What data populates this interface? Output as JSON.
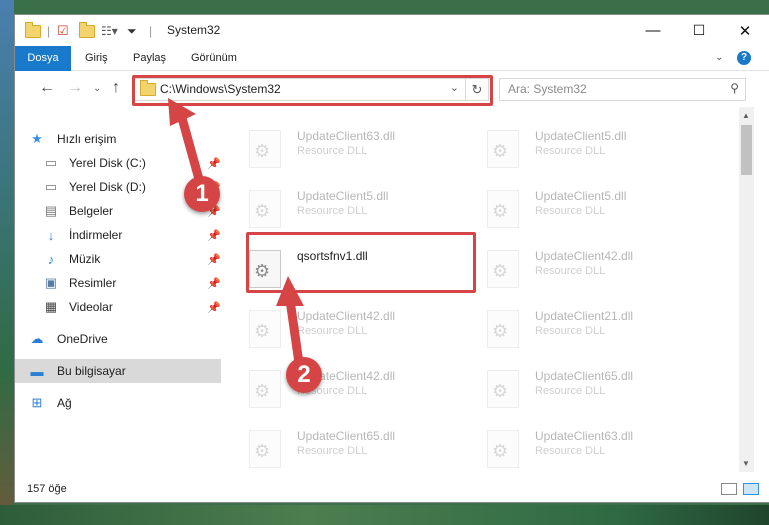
{
  "window": {
    "title": "System32",
    "controls": {
      "minimize": "—",
      "maximize": "☐",
      "close": "✕"
    }
  },
  "ribbon": {
    "tabs": [
      "Dosya",
      "Giriş",
      "Paylaş",
      "Görünüm"
    ],
    "expand_icon": "chevron-down-icon",
    "help": "?"
  },
  "address": {
    "path": "C:\\Windows\\System32",
    "dropdown": "⌄",
    "refresh": "↻"
  },
  "search": {
    "placeholder": "Ara: System32"
  },
  "nav": {
    "items": [
      {
        "label": "Hızlı erişim",
        "icon": "star-icon",
        "pinned": false
      },
      {
        "label": "Yerel Disk (C:)",
        "icon": "drive-icon",
        "pinned": true
      },
      {
        "label": "Yerel Disk (D:)",
        "icon": "drive-icon",
        "pinned": true
      },
      {
        "label": "Belgeler",
        "icon": "documents-icon",
        "pinned": true
      },
      {
        "label": "İndirmeler",
        "icon": "download-icon",
        "pinned": true
      },
      {
        "label": "Müzik",
        "icon": "music-icon",
        "pinned": true
      },
      {
        "label": "Resimler",
        "icon": "pictures-icon",
        "pinned": true
      },
      {
        "label": "Videolar",
        "icon": "video-icon",
        "pinned": true
      },
      {
        "label": "OneDrive",
        "icon": "cloud-icon",
        "pinned": false
      },
      {
        "label": "Bu bilgisayar",
        "icon": "computer-icon",
        "pinned": false,
        "selected": true
      },
      {
        "label": "Ağ",
        "icon": "network-icon",
        "pinned": false
      }
    ]
  },
  "files": [
    {
      "name": "UpdateClient63.dll",
      "type": "Resource DLL",
      "faded": true
    },
    {
      "name": "UpdateClient5.dll",
      "type": "Resource DLL",
      "faded": true
    },
    {
      "name": "UpdateClient5.dll",
      "type": "Resource DLL",
      "faded": true
    },
    {
      "name": "UpdateClient5.dll",
      "type": "Resource DLL",
      "faded": true
    },
    {
      "name": "qsortsfnv1.dll",
      "type": "",
      "faded": false
    },
    {
      "name": "UpdateClient42.dll",
      "type": "Resource DLL",
      "faded": true
    },
    {
      "name": "UpdateClient42.dll",
      "type": "Resource DLL",
      "faded": true
    },
    {
      "name": "UpdateClient21.dll",
      "type": "Resource DLL",
      "faded": true
    },
    {
      "name": "UpdateClient42.dll",
      "type": "Resource DLL",
      "faded": true
    },
    {
      "name": "UpdateClient65.dll",
      "type": "Resource DLL",
      "faded": true
    },
    {
      "name": "UpdateClient65.dll",
      "type": "Resource DLL",
      "faded": true
    },
    {
      "name": "UpdateClient63.dll",
      "type": "Resource DLL",
      "faded": true
    }
  ],
  "status": {
    "count": "157 öğe"
  },
  "annotations": {
    "badge1": "1",
    "badge2": "2",
    "color": "#d64545"
  }
}
